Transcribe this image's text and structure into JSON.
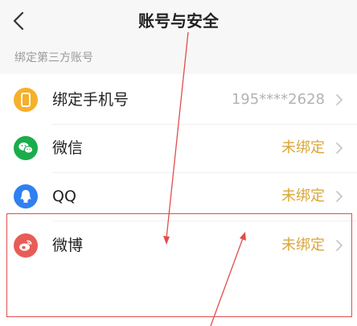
{
  "header": {
    "title": "账号与安全"
  },
  "section": {
    "label": "绑定第三方账号"
  },
  "rows": [
    {
      "label": "绑定手机号",
      "value": "195****2628",
      "value_color": "#b3b3b3",
      "icon": "phone-icon",
      "icon_color": "#f6b02a"
    },
    {
      "label": "微信",
      "value": "未绑定",
      "value_color": "#d9a63a",
      "icon": "wechat-icon",
      "icon_color": "#1aad4a"
    },
    {
      "label": "QQ",
      "value": "未绑定",
      "value_color": "#d9a63a",
      "icon": "qq-icon",
      "icon_color": "#2f80f0"
    },
    {
      "label": "微博",
      "value": "未绑定",
      "value_color": "#d9a63a",
      "icon": "weibo-icon",
      "icon_color": "#e85c56"
    }
  ],
  "colors": {
    "annotation": "#e24d4d"
  }
}
